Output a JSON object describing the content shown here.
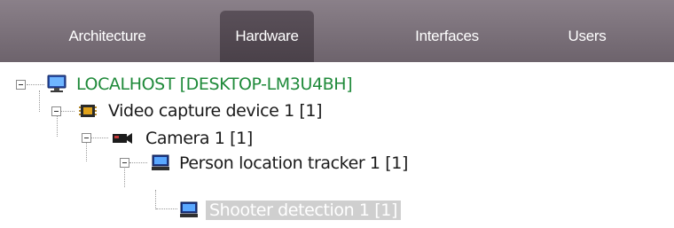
{
  "tabs": [
    {
      "label": "Architecture",
      "active": false
    },
    {
      "label": "Hardware",
      "active": true
    },
    {
      "label": "Interfaces",
      "active": false
    },
    {
      "label": "Users",
      "active": false
    }
  ],
  "tree": {
    "server": {
      "label": "LOCALHOST [DESKTOP-LM3U4BH]",
      "icon": "computer-icon"
    },
    "video_capture": {
      "label": "Video capture device 1 [1]",
      "icon": "capture-board-icon"
    },
    "camera": {
      "label": "Camera 1 [1]",
      "icon": "camera-icon"
    },
    "tracker": {
      "label": "Person location tracker 1 [1]",
      "icon": "monitor-icon"
    },
    "shooter": {
      "label": "Shooter detection 1 [1]",
      "icon": "monitor-icon",
      "selected": true
    }
  },
  "colors": {
    "tabbar": "#7a7079",
    "tab_active": "#4f464e",
    "server_text": "#1f8a3a",
    "selection": "#cfcfcf"
  }
}
